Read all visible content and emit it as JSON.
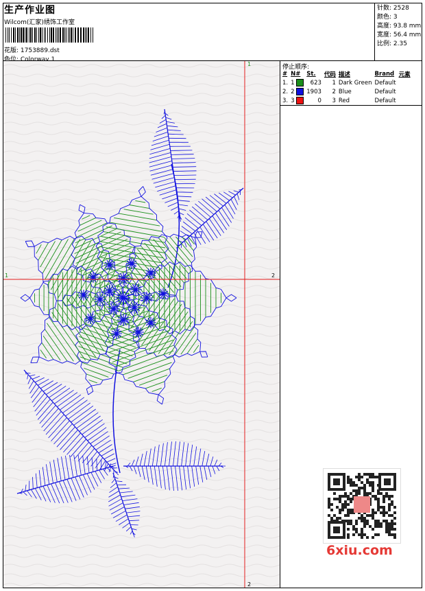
{
  "header": {
    "title": "生产作业图",
    "company": "Wilcom(汇家)绣饰工作室",
    "design_label": "花版: 1753889.dst",
    "color_label": "色位: Colorway 1"
  },
  "stats": {
    "stitches": "针数: 2528",
    "colors": "颜色: 3",
    "height": "高度: 93.8 mm",
    "width": "宽度: 56.4 mm",
    "ratio": "比例: 2.35"
  },
  "stop_sequence": {
    "title": "停止顺序:",
    "headers": [
      "#",
      "N#",
      "St.",
      "代码",
      "描述",
      "Brand",
      "元素"
    ],
    "rows": [
      {
        "idx": "1.",
        "n": "1",
        "st": "623",
        "code": "1",
        "desc": "Dark Green",
        "brand": "Default",
        "color": "#1a8f1a"
      },
      {
        "idx": "2.",
        "n": "2",
        "st": "1903",
        "code": "2",
        "desc": "Blue",
        "brand": "Default",
        "color": "#1010e0"
      },
      {
        "idx": "3.",
        "n": "3",
        "st": "0",
        "code": "3",
        "desc": "Red",
        "brand": "Default",
        "color": "#ee1111"
      }
    ]
  },
  "axes": {
    "v_top": "1",
    "v_bottom": "2",
    "h_left": "1",
    "h_right": "2"
  },
  "watermark": "6xiu.com",
  "colors": {
    "green": "#1a8f1a",
    "blue": "#1010e0",
    "red": "#e31b1b"
  }
}
